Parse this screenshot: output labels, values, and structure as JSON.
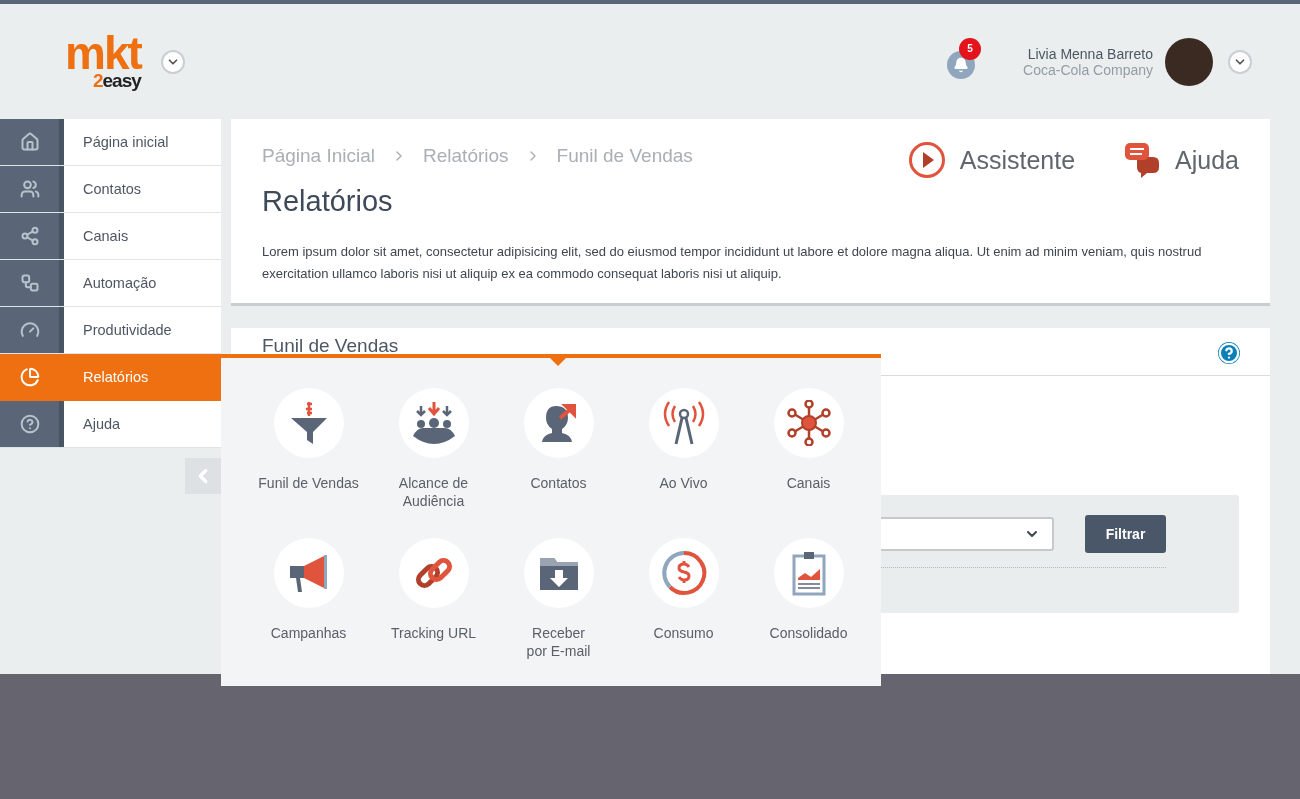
{
  "logo": {
    "wordmark": "mkt",
    "tagline_number": "2",
    "tagline": "easy"
  },
  "notifications": {
    "count": "5"
  },
  "user": {
    "name": "Livia Menna Barreto",
    "company": "Coca-Cola Company"
  },
  "sidebar": {
    "items": [
      {
        "label": "Página inicial",
        "kind": "home",
        "selected": false
      },
      {
        "label": "Contatos",
        "kind": "contacts",
        "selected": false
      },
      {
        "label": "Canais",
        "kind": "channels",
        "selected": false
      },
      {
        "label": "Automação",
        "kind": "automation",
        "selected": false
      },
      {
        "label": "Produtividade",
        "kind": "gauge",
        "selected": false
      },
      {
        "label": "Relatórios",
        "kind": "reports",
        "selected": true
      },
      {
        "label": "Ajuda",
        "kind": "help",
        "selected": false
      }
    ]
  },
  "breadcrumb": [
    "Página Inicial",
    "Relatórios",
    "Funil de Vendas"
  ],
  "page_title": "Relatórios",
  "actions": [
    {
      "label": "Assistente",
      "kind": "play"
    },
    {
      "label": "Ajuda",
      "kind": "chat"
    }
  ],
  "description": "Lorem ipsum dolor sit amet, consectetur adipisicing elit, sed do eiusmod tempor incididunt ut labore et dolore magna aliqua. Ut enim ad minim veniam, quis nostrud exercitation ullamco laboris nisi ut aliquip ex ea commodo consequat  laboris nisi ut aliquip.",
  "panel": {
    "title": "Funil de Vendas",
    "filter_button": "Filtrar"
  },
  "reports_menu": {
    "items": [
      {
        "label": "Funil de Vendas",
        "kind": "funnel"
      },
      {
        "label": "Alcance de Audiência",
        "kind": "audience"
      },
      {
        "label": "Contatos",
        "kind": "contact"
      },
      {
        "label": "Ao Vivo",
        "kind": "live"
      },
      {
        "label": "Canais",
        "kind": "network"
      },
      {
        "label": "Campanhas",
        "kind": "megaphone"
      },
      {
        "label": "Tracking URL",
        "kind": "link"
      },
      {
        "label": "Receber\npor E-mail",
        "kind": "folder"
      },
      {
        "label": "Consumo",
        "kind": "money"
      },
      {
        "label": "Consolidado",
        "kind": "clipboard"
      }
    ]
  }
}
